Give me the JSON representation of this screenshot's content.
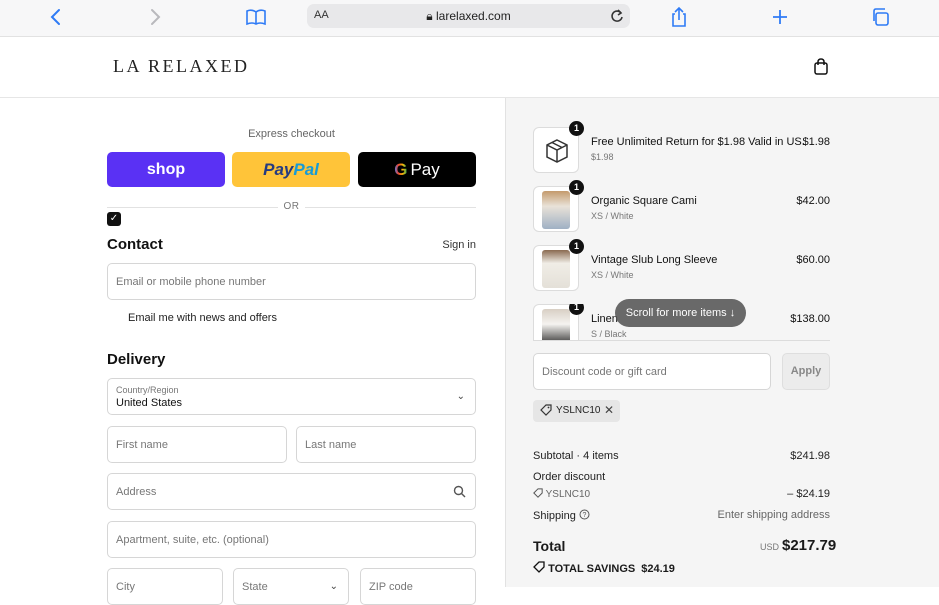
{
  "browser": {
    "text_size_label": "AA",
    "url": "larelaxed.com"
  },
  "header": {
    "logo": "LA RELAXED"
  },
  "express": {
    "label": "Express checkout",
    "shop_label": "shop",
    "paypal_pay": "Pay",
    "paypal_pal": "Pal",
    "gpay_g": "G",
    "gpay_label": "Pay",
    "or_label": "OR"
  },
  "contact": {
    "title": "Contact",
    "sign_in": "Sign in",
    "email_placeholder": "Email or mobile phone number",
    "newsletter_label": "Email me with news and offers",
    "newsletter_checked": true
  },
  "delivery": {
    "title": "Delivery",
    "country_label": "Country/Region",
    "country_value": "United States",
    "first_name_placeholder": "First name",
    "last_name_placeholder": "Last name",
    "address_placeholder": "Address",
    "apartment_placeholder": "Apartment, suite, etc. (optional)",
    "city_placeholder": "City",
    "state_placeholder": "State",
    "zip_placeholder": "ZIP code"
  },
  "cart": {
    "items": [
      {
        "name": "Free Unlimited Return for $1.98 Valid in US.",
        "variant": "$1.98",
        "price": "$1.98",
        "qty": "1"
      },
      {
        "name": "Organic Square Cami",
        "variant": "XS / White",
        "price": "$42.00",
        "qty": "1"
      },
      {
        "name": "Vintage Slub Long Sleeve",
        "variant": "XS / White",
        "price": "$60.00",
        "qty": "1"
      },
      {
        "name": "Linen",
        "variant": "S / Black",
        "price": "$138.00",
        "qty": "1"
      }
    ],
    "scroll_hint": "Scroll for more items ↓"
  },
  "discount": {
    "placeholder": "Discount code or gift card",
    "apply_label": "Apply",
    "applied_code": "YSLNC10"
  },
  "summary": {
    "subtotal_label": "Subtotal · 4 items",
    "subtotal_value": "$241.98",
    "order_discount_label": "Order discount",
    "discount_code": "YSLNC10",
    "discount_value": "– $24.19",
    "shipping_label": "Shipping",
    "shipping_value": "Enter shipping address",
    "total_label": "Total",
    "currency": "USD",
    "total_value": "$217.79",
    "savings_label": "TOTAL SAVINGS",
    "savings_value": "$24.19"
  }
}
